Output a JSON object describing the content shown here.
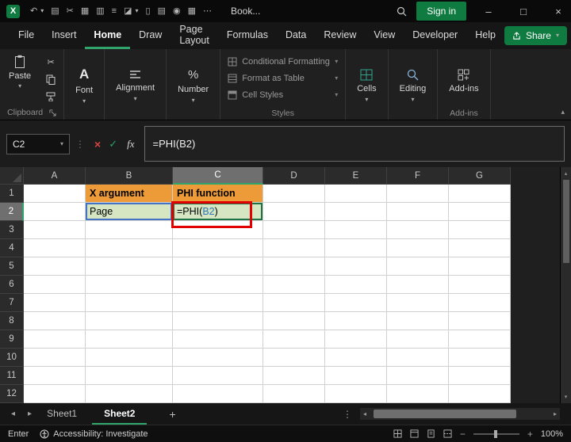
{
  "app": {
    "logo": "X",
    "title": "Book...",
    "sign_in": "Sign in"
  },
  "win": {
    "minimize": "–",
    "maximize": "□",
    "close": "×"
  },
  "qat": {
    "undo": "↶",
    "undo_dd": "▾",
    "clipboard": "▤",
    "cut": "✂",
    "picture": "▦",
    "chart": "▥",
    "database": "≡",
    "fill": "◪",
    "dd": "▾",
    "document": "▯",
    "print": "▤",
    "camera": "◉",
    "table": "▦",
    "overflow": "⋯"
  },
  "glyph": {
    "chev": "▾",
    "collapse": "▴",
    "A": "A",
    "percent": "%",
    "up": "▴",
    "down": "▾",
    "left": "◂",
    "right": "▸",
    "dots_v": "⋮",
    "minus": "−",
    "plus": "+"
  },
  "menu": {
    "tabs": [
      {
        "label": "File"
      },
      {
        "label": "Insert"
      },
      {
        "label": "Home"
      },
      {
        "label": "Draw"
      },
      {
        "label": "Page Layout"
      },
      {
        "label": "Formulas"
      },
      {
        "label": "Data"
      },
      {
        "label": "Review"
      },
      {
        "label": "View"
      },
      {
        "label": "Developer"
      },
      {
        "label": "Help"
      }
    ],
    "active_tab": "Home",
    "share_label": "Share"
  },
  "ribbon": {
    "paste_label": "Paste",
    "clipboard_group": "Clipboard",
    "font_label": "Font",
    "alignment_label": "Alignment",
    "number_label": "Number",
    "styles_items": [
      {
        "label": "Conditional Formatting"
      },
      {
        "label": "Format as Table"
      },
      {
        "label": "Cell Styles"
      }
    ],
    "styles_group": "Styles",
    "cells_label": "Cells",
    "editing_label": "Editing",
    "addins_label": "Add-ins",
    "addins_group": "Add-ins"
  },
  "formula_bar": {
    "name_box": "C2",
    "formula": "=PHI(B2)"
  },
  "grid": {
    "columns": [
      "A",
      "B",
      "C",
      "D",
      "E",
      "F",
      "G"
    ],
    "row_count": 12,
    "selected_column": "C",
    "selected_row": 2,
    "cells": [
      {
        "ref": "B1",
        "text": "X argument",
        "bold": true,
        "bg": "#EC9B38"
      },
      {
        "ref": "C1",
        "text": "PHI function",
        "bold": true,
        "bg": "#EC9B38"
      },
      {
        "ref": "B2",
        "text": "Page",
        "bg": "#D6E6C3",
        "border": "#4472C4"
      },
      {
        "ref": "C2",
        "bg": "#D6E6C3",
        "border": "#1E7145",
        "parts": [
          {
            "text": "=PHI(",
            "color": "#000000"
          },
          {
            "text": "B2",
            "color": "#2E75B6"
          },
          {
            "text": ")",
            "color": "#000000"
          }
        ]
      }
    ],
    "colors": {
      "annotation_red": "#E00000",
      "reference_blue": "#2E75B6",
      "header_orange": "#EC9B38",
      "cell_green": "#D6E6C3",
      "accent_green": "#107C41"
    }
  },
  "sheet_bar": {
    "tabs": [
      {
        "label": "Sheet1"
      },
      {
        "label": "Sheet2"
      }
    ],
    "active_tab": "Sheet2",
    "add": "+"
  },
  "status_bar": {
    "mode": "Enter",
    "accessibility": "Accessibility: Investigate",
    "zoom": "100%"
  }
}
